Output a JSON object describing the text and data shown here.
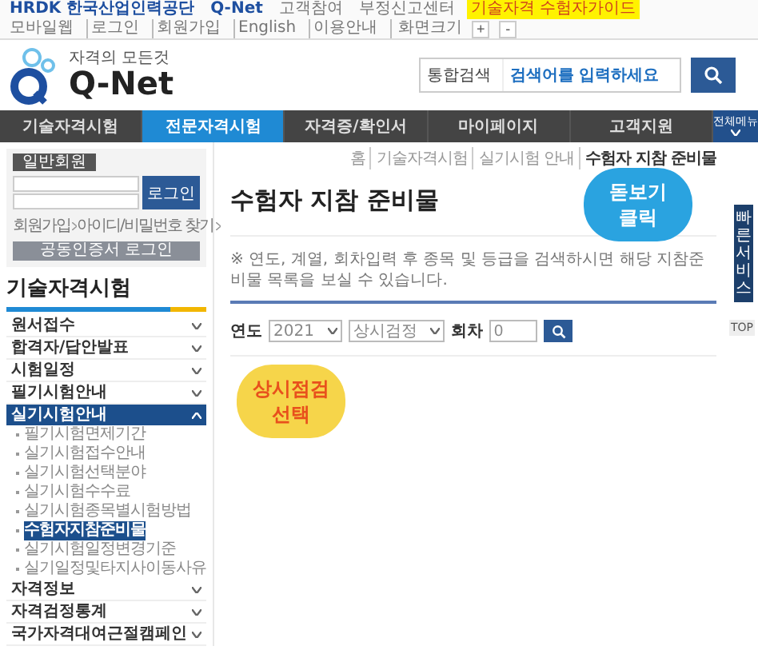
{
  "top_bar": {
    "left_links": [
      {
        "text": "HRDK 한국산업인력공단",
        "kind": "logo"
      },
      {
        "text": "Q-Net",
        "kind": "logo"
      },
      {
        "text": "고객참여",
        "kind": "link"
      },
      {
        "text": "부정신고센터",
        "kind": "link"
      },
      {
        "text": "기술자격 수험자가이드",
        "kind": "highlight"
      }
    ],
    "right_links": [
      "모바일웹",
      "로그인",
      "회원가입",
      "English",
      "이용안내"
    ],
    "zoom_label": "화면크기",
    "zoom_buttons": [
      "+",
      "-"
    ]
  },
  "header": {
    "logo_tagline": "자격의 모든것",
    "logo_text": "Q-Net",
    "search_category": "통합검색",
    "search_placeholder": "검색어를 입력하세요"
  },
  "nav": [
    {
      "label": "기술자격시험",
      "selected": false
    },
    {
      "label": "전문자격시험",
      "selected": true
    },
    {
      "label": "자격증/확인서",
      "selected": false
    },
    {
      "label": "마이페이지",
      "selected": false
    },
    {
      "label": "고객지원",
      "selected": false
    }
  ],
  "all_menu": "전체메뉴",
  "login": {
    "tag": "일반회원",
    "button": "로그인",
    "links": [
      "회원가입",
      "아이디/비밀번호 찾기"
    ],
    "cert_button": "공동인증서 로그인"
  },
  "sidebar": {
    "title": "기술자격시험",
    "items": [
      {
        "label": "원서접수",
        "expanded": false,
        "selected": false
      },
      {
        "label": "합격자/답안발표",
        "expanded": false,
        "selected": false
      },
      {
        "label": "시험일정",
        "expanded": false,
        "selected": false
      },
      {
        "label": "필기시험안내",
        "expanded": false,
        "selected": false
      },
      {
        "label": "실기시험안내",
        "expanded": true,
        "selected": true,
        "children": [
          {
            "label": "필기시험면제기간",
            "selected": false
          },
          {
            "label": "실기시험접수안내",
            "selected": false
          },
          {
            "label": "실기시험선택분야",
            "selected": false
          },
          {
            "label": "실기시험수수료",
            "selected": false
          },
          {
            "label": "실기시험종목별시험방법",
            "selected": false
          },
          {
            "label": "수험자지참준비물",
            "selected": true
          },
          {
            "label": "실기시험일정변경기준",
            "selected": false
          },
          {
            "label": "실기일정및타지사이동사유",
            "selected": false
          }
        ]
      },
      {
        "label": "자격정보",
        "expanded": false,
        "selected": false
      },
      {
        "label": "자격검정통계",
        "expanded": false,
        "selected": false
      },
      {
        "label": "국가자격대여근절캠페인",
        "expanded": false,
        "selected": false
      }
    ]
  },
  "content": {
    "breadcrumb": [
      "홈",
      "기술자격시험",
      "실기시험 안내",
      "수험자 지참 준비물"
    ],
    "title": "수험자 지참 준비물",
    "notice": "※ 연도, 계열, 회차입력 후 종목 및 등급을 검색하시면 해당 지참준비물 목록을 보실 수 있습니다.",
    "year_label": "연도",
    "year": "2021",
    "type": "상시검정",
    "round_label": "회차",
    "round": "0"
  },
  "callouts": [
    {
      "text": "돋보기 클릭",
      "color": "#2aa3e0"
    },
    {
      "text": "상시점검 선택",
      "color": "#f6d54a"
    }
  ],
  "quick_menu": {
    "label": "빠른서비스",
    "top": "TOP"
  }
}
